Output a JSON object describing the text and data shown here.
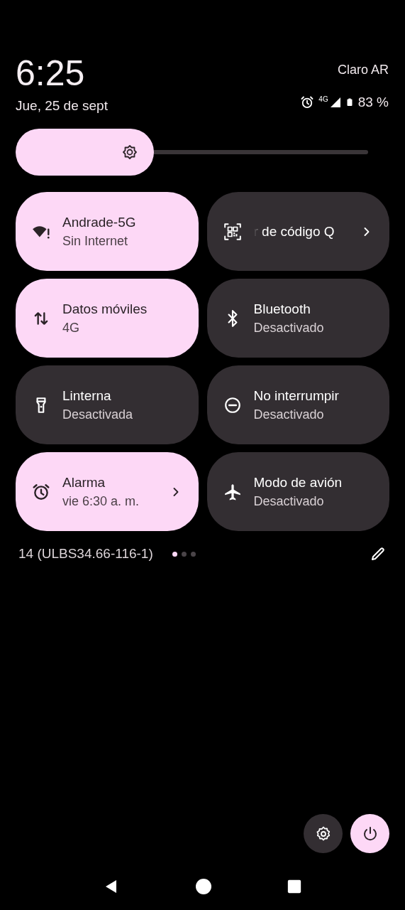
{
  "header": {
    "time": "6:25",
    "carrier": "Claro AR",
    "date": "Jue, 25 de sept",
    "network_type": "4G",
    "battery_text": "83 %"
  },
  "brightness": {
    "level": 0.37
  },
  "tiles": [
    {
      "kind": "wifi",
      "title": "Andrade-5G",
      "subtitle": "Sin Internet",
      "on": true,
      "chevron": false
    },
    {
      "kind": "qr",
      "title": "r de código Q",
      "on": false,
      "chevron": true
    },
    {
      "kind": "data",
      "title": "Datos móviles",
      "subtitle": "4G",
      "on": true,
      "chevron": false
    },
    {
      "kind": "bluetooth",
      "title": "Bluetooth",
      "subtitle": "Desactivado",
      "on": false,
      "chevron": false
    },
    {
      "kind": "flashlight",
      "title": "Linterna",
      "subtitle": "Desactivada",
      "on": false,
      "chevron": false
    },
    {
      "kind": "dnd",
      "title": "No interrumpir",
      "subtitle": "Desactivado",
      "on": false,
      "chevron": false
    },
    {
      "kind": "alarm",
      "title": "Alarma",
      "subtitle": "vie 6:30 a. m.",
      "on": true,
      "chevron": true
    },
    {
      "kind": "airplane",
      "title": "Modo de avión",
      "subtitle": "Desactivado",
      "on": false,
      "chevron": false
    }
  ],
  "footer": {
    "build": "14 (ULBS34.66-116-1)",
    "pages": [
      {
        "selected": true
      },
      {
        "selected": false
      },
      {
        "selected": false
      }
    ]
  }
}
